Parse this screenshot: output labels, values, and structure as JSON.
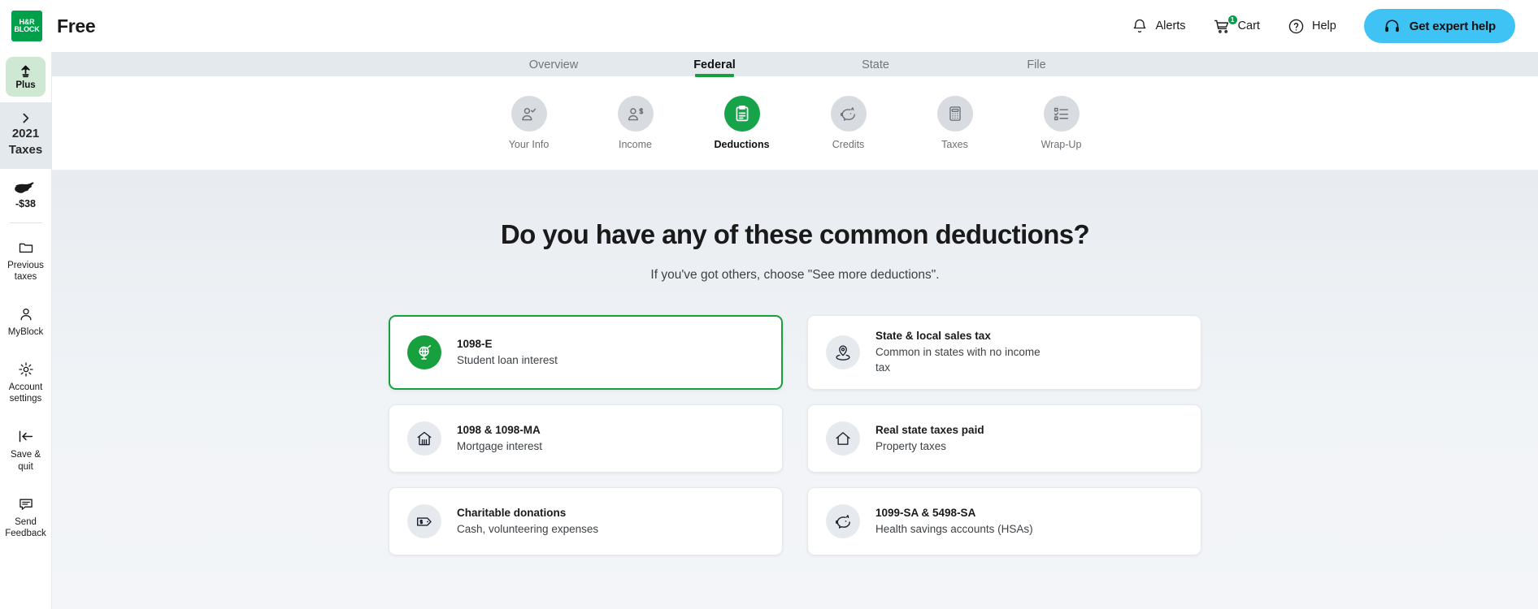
{
  "header": {
    "logo_lines": [
      "H&R",
      "BLOCK"
    ],
    "product_name": "Free",
    "alerts_label": "Alerts",
    "cart_label": "Cart",
    "cart_badge": "1",
    "help_label": "Help",
    "expert_label": "Get expert help",
    "expert_bg": "#3fc3f4",
    "brand_green": "#00a04a"
  },
  "sidebar": {
    "plus_label": "Plus",
    "year_line1": "2021",
    "year_line2": "Taxes",
    "refund_amount": "-$38",
    "items": [
      {
        "label_line1": "Previous",
        "label_line2": "taxes",
        "icon": "folder-icon"
      },
      {
        "label_line1": "MyBlock",
        "label_line2": "",
        "icon": "person-icon"
      },
      {
        "label_line1": "Account",
        "label_line2": "settings",
        "icon": "gear-icon"
      },
      {
        "label_line1": "Save &",
        "label_line2": "quit",
        "icon": "save-quit-icon"
      },
      {
        "label_line1": "Send",
        "label_line2": "Feedback",
        "icon": "chat-icon"
      }
    ]
  },
  "nav": {
    "tabs": [
      {
        "label": "Overview",
        "active": false
      },
      {
        "label": "Federal",
        "active": true
      },
      {
        "label": "State",
        "active": false
      },
      {
        "label": "File",
        "active": false
      }
    ],
    "active_underline_color": "#14a03c"
  },
  "steps": [
    {
      "label": "Your Info",
      "icon": "person-check-icon",
      "active": false
    },
    {
      "label": "Income",
      "icon": "person-dollar-icon",
      "active": false
    },
    {
      "label": "Deductions",
      "icon": "clipboard-icon",
      "active": true
    },
    {
      "label": "Credits",
      "icon": "piggy-bank-icon",
      "active": false
    },
    {
      "label": "Taxes",
      "icon": "calculator-icon",
      "active": false
    },
    {
      "label": "Wrap-Up",
      "icon": "checklist-icon",
      "active": false
    }
  ],
  "main": {
    "title": "Do you have any of these common deductions?",
    "subtitle": "If you've got others, choose \"See more deductions\".",
    "cards": [
      {
        "title": "1098-E",
        "desc": "Student loan interest",
        "icon": "graduation-globe-icon",
        "selected": true
      },
      {
        "title": "State & local sales tax",
        "desc": "Common in states with no income tax",
        "icon": "map-pin-icon",
        "selected": false
      },
      {
        "title": "1098 & 1098-MA",
        "desc": "Mortgage interest",
        "icon": "house-lines-icon",
        "selected": false
      },
      {
        "title": "Real state taxes paid",
        "desc": "Property taxes",
        "icon": "house-icon",
        "selected": false
      },
      {
        "title": "Charitable donations",
        "desc": "Cash, volunteering expenses",
        "icon": "price-tag-dollar-icon",
        "selected": false
      },
      {
        "title": "1099-SA & 5498-SA",
        "desc": "Health savings accounts (HSAs)",
        "icon": "piggy-bank-icon",
        "selected": false
      }
    ]
  }
}
